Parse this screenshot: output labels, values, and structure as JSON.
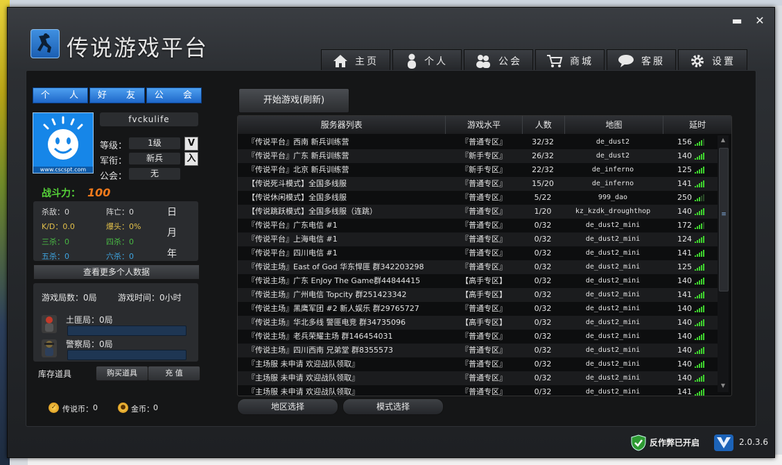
{
  "app": {
    "title": "传说游戏平台",
    "version": "2.0.3.6"
  },
  "window_controls": {
    "minimize": "▬",
    "close": "✕"
  },
  "nav": [
    {
      "label": "主页",
      "icon": "home-icon"
    },
    {
      "label": "个人",
      "icon": "person-icon"
    },
    {
      "label": "公会",
      "icon": "group-icon"
    },
    {
      "label": "商城",
      "icon": "cart-icon"
    },
    {
      "label": "客服",
      "icon": "chat-icon"
    },
    {
      "label": "设置",
      "icon": "gear-icon"
    }
  ],
  "profile_tabs": [
    "个 人",
    "好 友",
    "公 会"
  ],
  "profile": {
    "avatar_url_text": "www.cscspt.com",
    "username": "fvckulife",
    "level_label": "等级：",
    "level": "1级",
    "level_badge": "V",
    "rank_label": "军衔：",
    "rank": "新兵",
    "rank_badge": "入",
    "guild_label": "公会：",
    "guild": "无"
  },
  "power": {
    "label": "战斗力：",
    "value": "100"
  },
  "stats": {
    "kills": "杀敌：0",
    "deaths": "阵亡：0",
    "kd": "K/D：0.0",
    "headshot": "爆头：0%",
    "triple": "三杀：0",
    "quad": "四杀：0",
    "penta": "五杀：0",
    "hexa": "六杀：0",
    "periods": [
      "日",
      "月",
      "年"
    ]
  },
  "more_button": "查看更多个人数据",
  "games": {
    "count": "游戏局数：0局",
    "time": "游戏时间：0小时",
    "t_side": "土匪局：0局",
    "ct_side": "警察局：0局"
  },
  "inventory": {
    "label": "库存道具",
    "buy": "购买道具",
    "recharge": "充 值"
  },
  "currency": {
    "legend_label": "传说币：",
    "legend_value": "0",
    "gold_label": "金币：",
    "gold_value": "0"
  },
  "start_button": "开始游戏(刷新)",
  "server_headers": [
    "服务器列表",
    "游戏水平",
    "人数",
    "地图",
    "延时"
  ],
  "servers": [
    [
      "『传说平台』西南 新兵训练营",
      "『普通专区』",
      "32/32",
      "de_dust2",
      "156"
    ],
    [
      "『传说平台』广东 新兵训练营",
      "『新手专区』",
      "26/32",
      "de_dust2",
      "140"
    ],
    [
      "『传说平台』北京 新兵训练营",
      "『新手专区』",
      "22/32",
      "de_inferno",
      "125"
    ],
    [
      "【传说死斗模式】全国多线服",
      "『普通专区』",
      "15/20",
      "de_inferno",
      "141"
    ],
    [
      "【传说休闲模式】全国多线服",
      "『普通专区』",
      "5/22",
      "999_dao",
      "250"
    ],
    [
      "【传说跳跃模式】全国多线服（连跳）",
      "『普通专区』",
      "1/20",
      "kz_kzdk_droughthop",
      "140"
    ],
    [
      "『传说平台』广东电信 #1",
      "『普通专区』",
      "0/32",
      "de_dust2_mini",
      "172"
    ],
    [
      "『传说平台』上海电信 #1",
      "『普通专区』",
      "0/32",
      "de_dust2_mini",
      "124"
    ],
    [
      "『传说平台』四川电信 #1",
      "『普通专区』",
      "0/32",
      "de_dust2_mini",
      "141"
    ],
    [
      "『传说主场』East of God 华东悍匪 群342203298",
      "『普通专区』",
      "0/32",
      "de_dust2_mini",
      "125"
    ],
    [
      "『传说主场』广东 EnJoy The Game群44844415",
      "【高手专区】",
      "0/32",
      "de_dust2_mini",
      "140"
    ],
    [
      "『传说主场』广州电信 Topcity 群251423342",
      "【高手专区】",
      "0/32",
      "de_dust2_mini",
      "141"
    ],
    [
      "『传说主场』黑鹰军团 #2 新人娱乐 群29765727",
      "『普通专区』",
      "0/32",
      "de_dust2_mini",
      "140"
    ],
    [
      "『传说主场』华北多线 警匪电竞 群34735096",
      "【高手专区】",
      "0/32",
      "de_dust2_mini",
      "140"
    ],
    [
      "『传说主场』老兵荣耀主场 群146454031",
      "『普通专区』",
      "0/32",
      "de_dust2_mini",
      "140"
    ],
    [
      "『传说主场』四川西南 兄弟堂 群8355573",
      "『普通专区』",
      "0/32",
      "de_dust2_mini",
      "140"
    ],
    [
      "『主场服 未申请 欢迎战队领取』",
      "『普通专区』",
      "0/32",
      "de_dust2_mini",
      "140"
    ],
    [
      "『主场服 未申请 欢迎战队领取』",
      "『普通专区』",
      "0/32",
      "de_dust2_mini",
      "140"
    ],
    [
      "『主场服 未申请 欢迎战队领取』",
      "『普通专区』",
      "0/32",
      "de_dust2_mini",
      "141"
    ]
  ],
  "region_button": "地区选择",
  "mode_button": "模式选择",
  "anticheat": "反作弊已开启",
  "colors": {
    "accent_blue": "#1e67c9",
    "power_green": "#55d238",
    "power_orange": "#f07a1c",
    "signal_green": "#3fd62e"
  }
}
